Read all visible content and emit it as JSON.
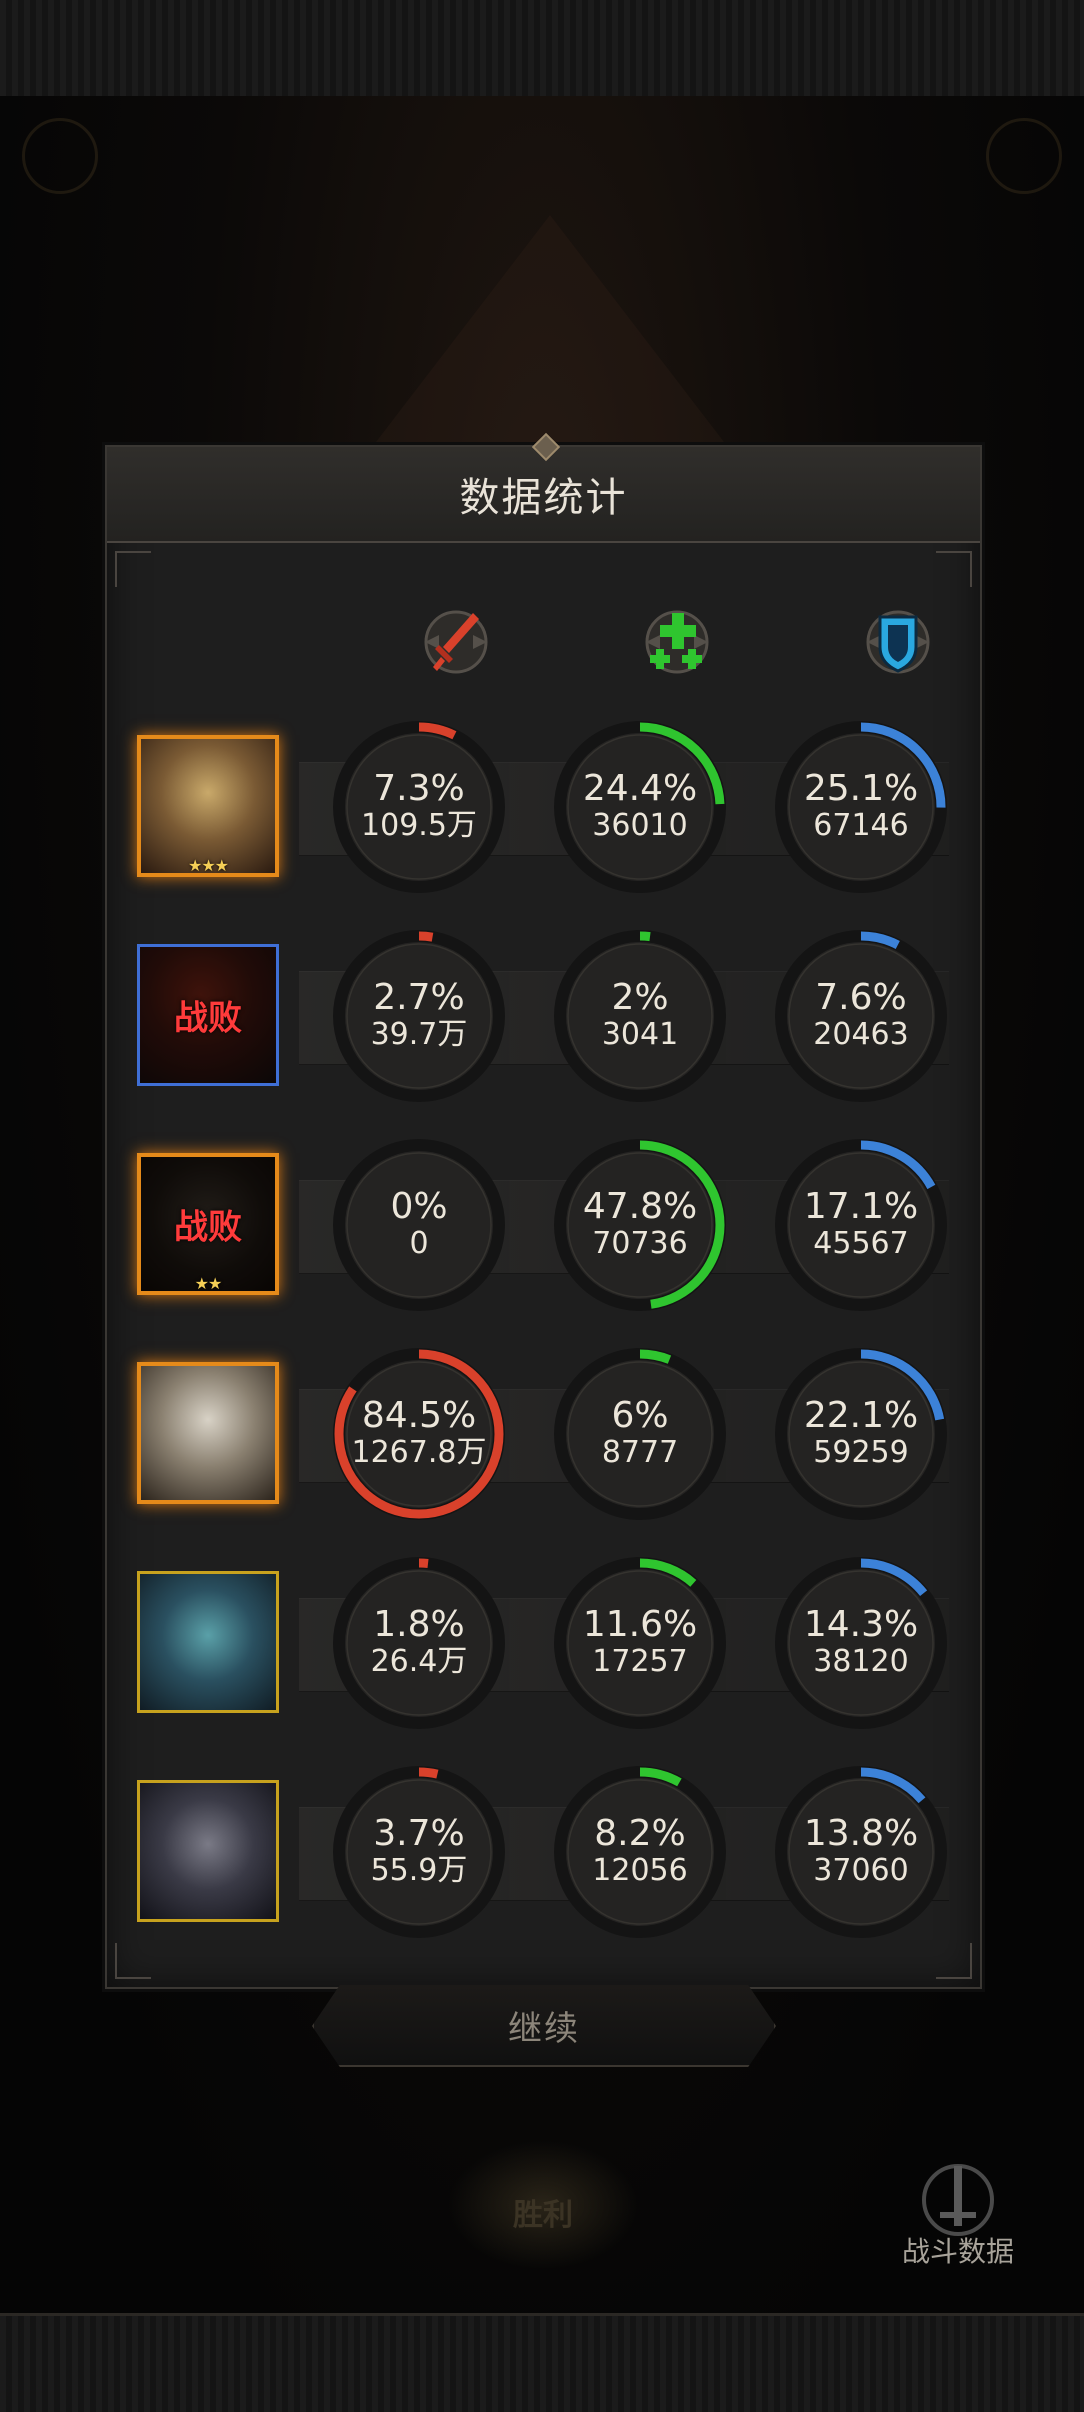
{
  "dialog": {
    "title": "数据统计"
  },
  "columns": [
    {
      "icon": "sword-icon",
      "color": "#d9412b"
    },
    {
      "icon": "heal-plus-icon",
      "color": "#2fc52f"
    },
    {
      "icon": "shield-icon",
      "color": "#3c82d8"
    }
  ],
  "heroes": [
    {
      "portrait": "blonde-warrior-portrait",
      "frame": "gold",
      "stars": "★★★",
      "defeated": false,
      "damage": {
        "pct": "7.3%",
        "value": "109.5万",
        "fraction": 0.073
      },
      "heal": {
        "pct": "24.4%",
        "value": "36010",
        "fraction": 0.244
      },
      "tank": {
        "pct": "25.1%",
        "value": "67146",
        "fraction": 0.251
      }
    },
    {
      "portrait": "red-hair-portrait",
      "frame": "blue",
      "stars": "",
      "defeated": true,
      "defeat_label": "战败",
      "damage": {
        "pct": "2.7%",
        "value": "39.7万",
        "fraction": 0.027
      },
      "heal": {
        "pct": "2%",
        "value": "3041",
        "fraction": 0.02
      },
      "tank": {
        "pct": "7.6%",
        "value": "20463",
        "fraction": 0.076
      }
    },
    {
      "portrait": "hooded-portrait",
      "frame": "gold",
      "stars": "★★",
      "defeated": true,
      "defeat_label": "战败",
      "damage": {
        "pct": "0%",
        "value": "0",
        "fraction": 0
      },
      "heal": {
        "pct": "47.8%",
        "value": "70736",
        "fraction": 0.478
      },
      "tank": {
        "pct": "17.1%",
        "value": "45567",
        "fraction": 0.171
      }
    },
    {
      "portrait": "silver-priestess-portrait",
      "frame": "gold",
      "stars": "",
      "defeated": false,
      "damage": {
        "pct": "84.5%",
        "value": "1267.8万",
        "fraction": 0.845
      },
      "heal": {
        "pct": "6%",
        "value": "8777",
        "fraction": 0.06
      },
      "tank": {
        "pct": "22.1%",
        "value": "59259",
        "fraction": 0.221
      }
    },
    {
      "portrait": "elf-portrait",
      "frame": "yellow",
      "stars": "",
      "defeated": false,
      "damage": {
        "pct": "1.8%",
        "value": "26.4万",
        "fraction": 0.018
      },
      "heal": {
        "pct": "11.6%",
        "value": "17257",
        "fraction": 0.116
      },
      "tank": {
        "pct": "14.3%",
        "value": "38120",
        "fraction": 0.143
      }
    },
    {
      "portrait": "werewolf-portrait",
      "frame": "yellow",
      "stars": "",
      "defeated": false,
      "damage": {
        "pct": "3.7%",
        "value": "55.9万",
        "fraction": 0.037
      },
      "heal": {
        "pct": "8.2%",
        "value": "12056",
        "fraction": 0.082
      },
      "tank": {
        "pct": "13.8%",
        "value": "37060",
        "fraction": 0.138
      }
    }
  ],
  "continue_button": {
    "label": "继续"
  },
  "background": {
    "battle_data_label": "战斗数据",
    "center_emblem_label": "胜利"
  }
}
